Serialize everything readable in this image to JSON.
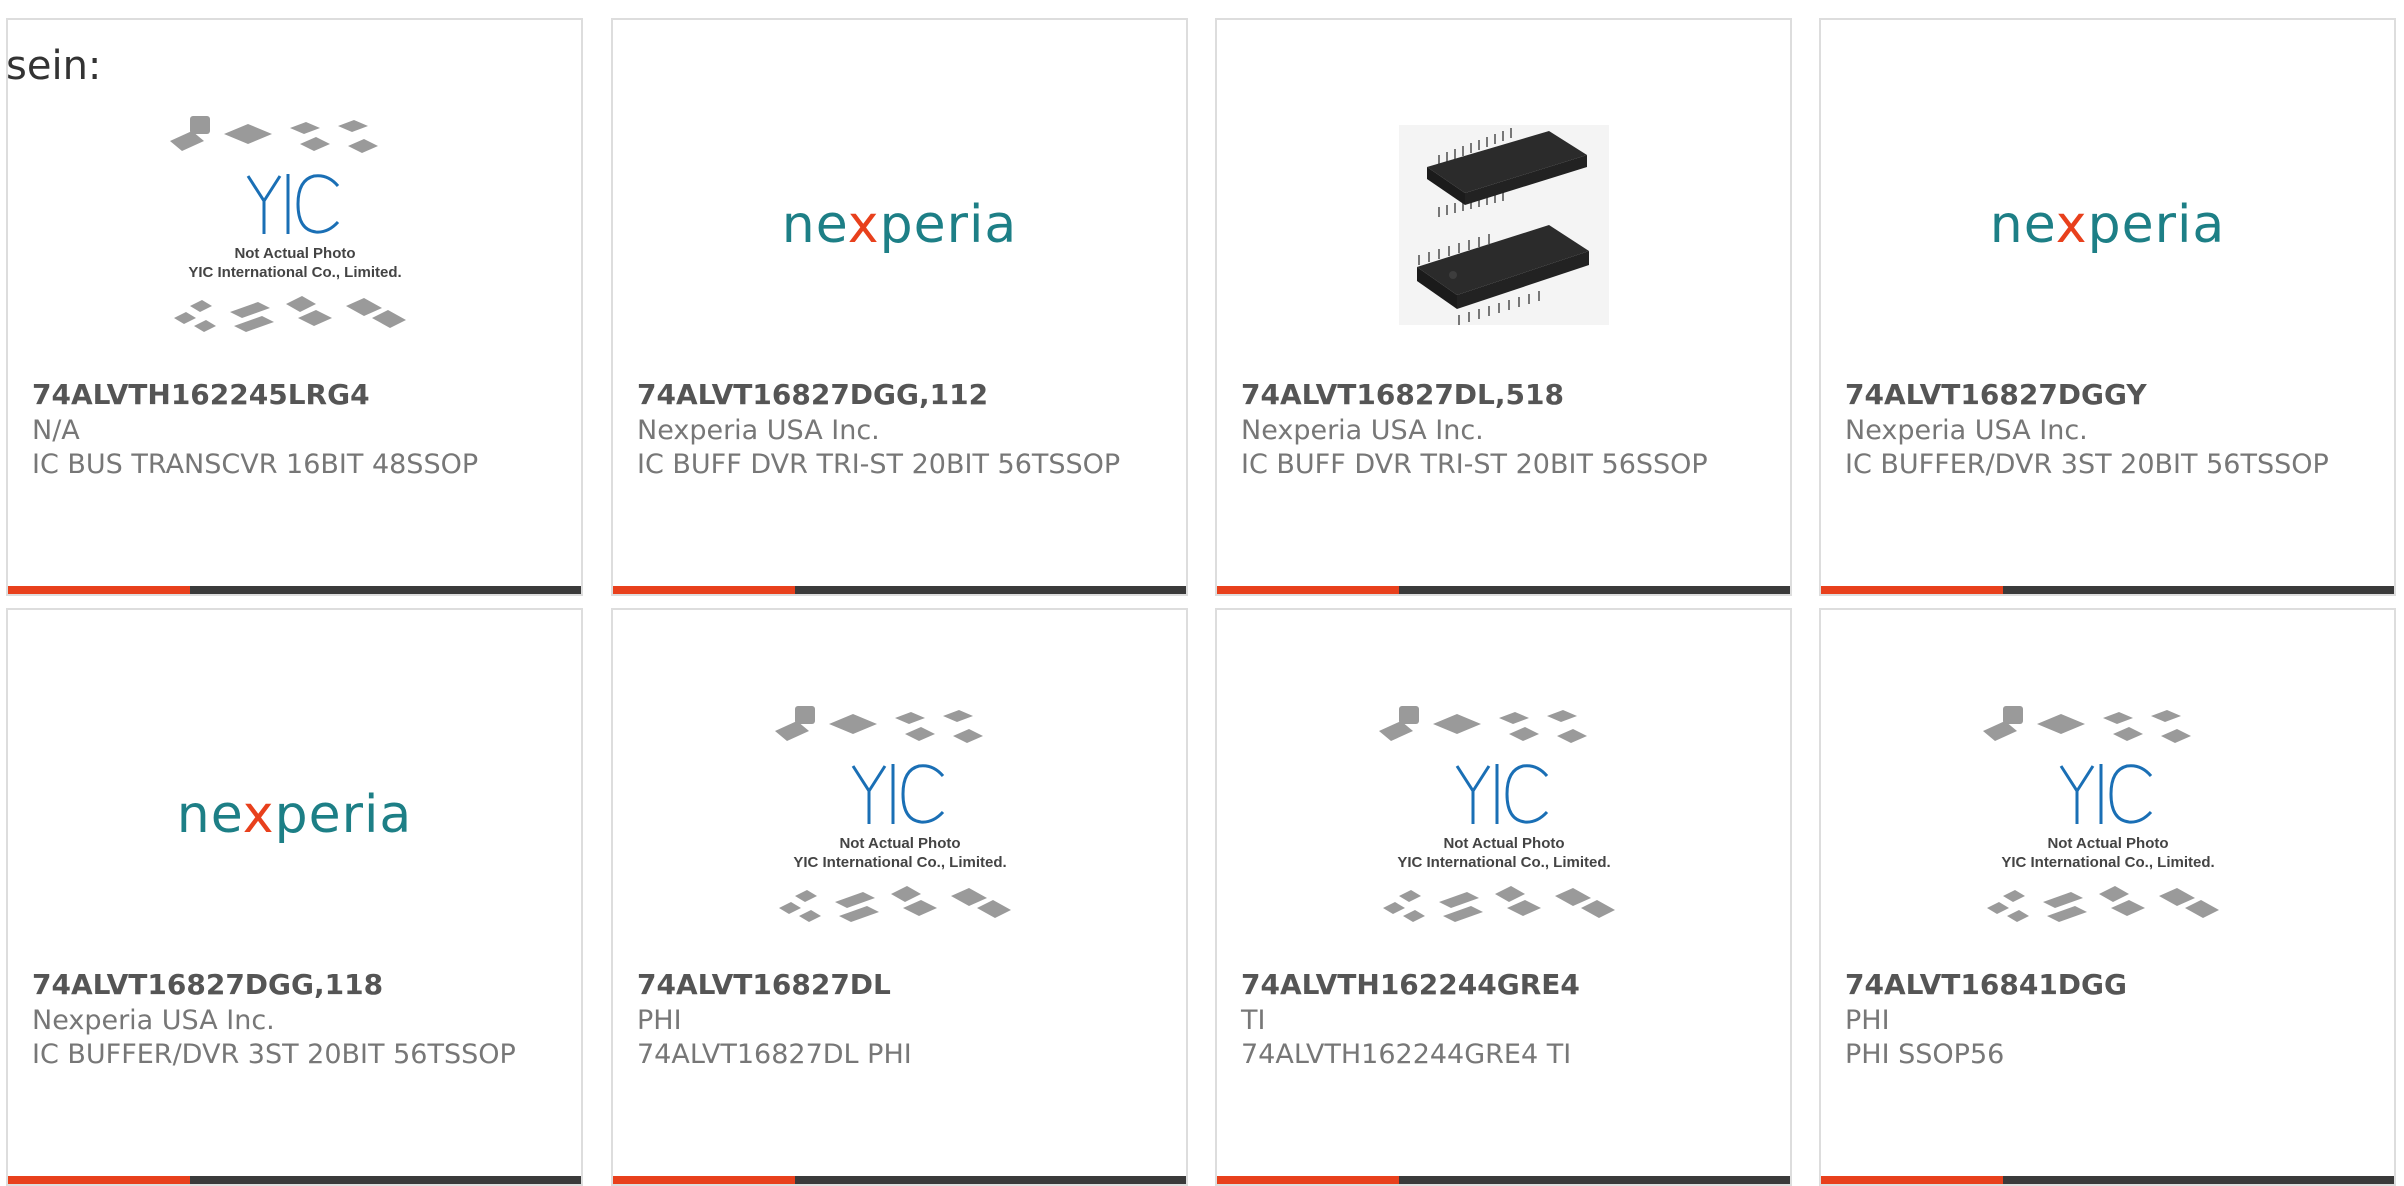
{
  "intro_text": "sein:",
  "placeholder": {
    "caption_line1": "Not Actual Photo",
    "caption_line2": "YIC International Co., Limited."
  },
  "logos": {
    "nexperia_pre": "ne",
    "nexperia_x": "x",
    "nexperia_post": "peria"
  },
  "products": [
    {
      "part_number": "74ALVTH162245LRG4",
      "manufacturer": "N/A",
      "description": "IC BUS TRANSCVR 16BIT 48SSOP",
      "image": "yic-placeholder"
    },
    {
      "part_number": "74ALVT16827DGG,112",
      "manufacturer": "Nexperia USA Inc.",
      "description": "IC BUFF DVR TRI-ST 20BIT 56TSSOP",
      "image": "nexperia-logo"
    },
    {
      "part_number": "74ALVT16827DL,518",
      "manufacturer": "Nexperia USA Inc.",
      "description": "IC BUFF DVR TRI-ST 20BIT 56SSOP",
      "image": "ic-chip-photo"
    },
    {
      "part_number": "74ALVT16827DGGY",
      "manufacturer": "Nexperia USA Inc.",
      "description": "IC BUFFER/DVR 3ST 20BIT 56TSSOP",
      "image": "nexperia-logo"
    },
    {
      "part_number": "74ALVT16827DGG,118",
      "manufacturer": "Nexperia USA Inc.",
      "description": "IC BUFFER/DVR 3ST 20BIT 56TSSOP",
      "image": "nexperia-logo"
    },
    {
      "part_number": "74ALVT16827DL",
      "manufacturer": "PHI",
      "description": "74ALVT16827DL PHI",
      "image": "yic-placeholder"
    },
    {
      "part_number": "74ALVTH162244GRE4",
      "manufacturer": "TI",
      "description": "74ALVTH162244GRE4 TI",
      "image": "yic-placeholder"
    },
    {
      "part_number": "74ALVT16841DGG",
      "manufacturer": "PHI",
      "description": "PHI SSOP56",
      "image": "yic-placeholder"
    }
  ],
  "colors": {
    "accent": "#e8401c",
    "bar_dark": "#3a3a3a",
    "nexperia_teal": "#1d7f86",
    "yic_blue": "#1a6fb5"
  }
}
